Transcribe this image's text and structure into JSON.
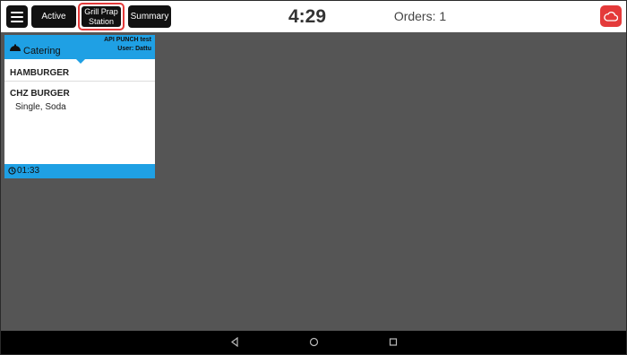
{
  "toolbar": {
    "menu_icon": "hamburger-icon",
    "active_label": "Active",
    "grill_label_line1": "Grill Prap",
    "grill_label_line2": "Station",
    "summary_label": "Summary",
    "cloud_icon": "cloud-icon",
    "highlight_color": "#e43a3a"
  },
  "status": {
    "clock": "4:29",
    "orders": "Orders: 1"
  },
  "order_card": {
    "type": "Catering",
    "type_icon": "bell-icon",
    "terminal": "API PUNCH test",
    "user": "User: Dattu",
    "accent_color": "#1fa0e4",
    "items": [
      {
        "name": "HAMBURGER",
        "modifiers": ""
      },
      {
        "name": "CHZ BURGER",
        "modifiers": "Single, Soda"
      }
    ],
    "timer_icon": "clock-icon",
    "elapsed": "01:33"
  },
  "navbar": {
    "back_icon": "back-triangle-icon",
    "home_icon": "home-circle-icon",
    "recent_icon": "recent-square-icon"
  }
}
